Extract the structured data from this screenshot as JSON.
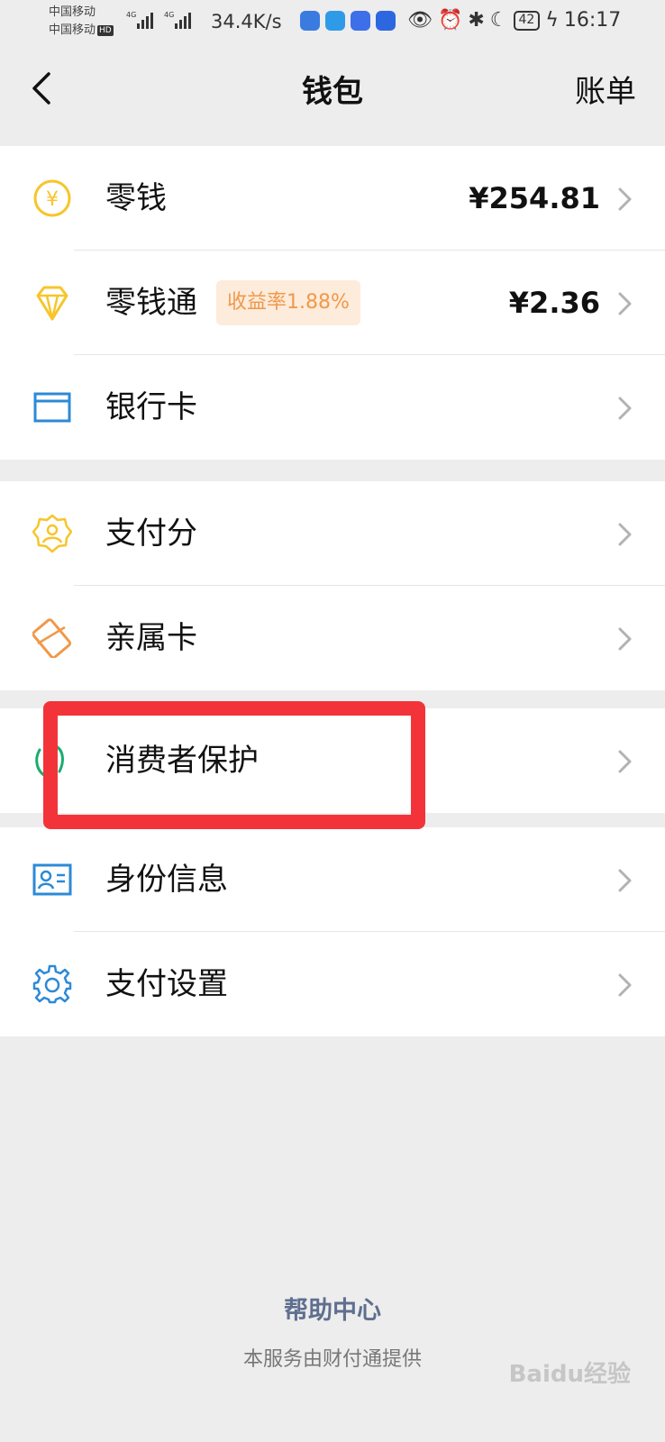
{
  "status_bar": {
    "carrier_1": "中国移动",
    "carrier_2": "中国移动",
    "hd_badge": "HD",
    "signal_label_1": "4G",
    "signal_label_2": "4G",
    "net_speed": "34.4K/s",
    "battery": "42",
    "time": "16:17",
    "icons": [
      "browser-app-icon",
      "message-app-icon",
      "baidu-app-icon",
      "bulb-app-icon",
      "eye-icon",
      "alarm-icon",
      "bluetooth-icon",
      "moon-icon",
      "battery-icon",
      "charging-icon"
    ]
  },
  "nav": {
    "back_icon": "chevron-left-icon",
    "title": "钱包",
    "right_action": "账单"
  },
  "groups": [
    {
      "items": [
        {
          "key": "change",
          "label": "零钱",
          "value": "¥254.81",
          "icon": "yuan-coin-icon",
          "color": "#f7c52a"
        },
        {
          "key": "change-pass",
          "label": "零钱通",
          "badge": "收益率1.88%",
          "value": "¥2.36",
          "icon": "diamond-icon",
          "color": "#f7c52a"
        },
        {
          "key": "bank-card",
          "label": "银行卡",
          "value": "",
          "icon": "bank-card-icon",
          "color": "#2c8ad6"
        }
      ]
    },
    {
      "items": [
        {
          "key": "pay-score",
          "label": "支付分",
          "value": "",
          "icon": "pay-score-badge-icon",
          "color": "#f7c52a"
        },
        {
          "key": "family-card",
          "label": "亲属卡",
          "value": "",
          "icon": "family-card-icon",
          "color": "#f0994a"
        }
      ]
    },
    {
      "items": [
        {
          "key": "consumer-protection",
          "label": "消费者保护",
          "value": "",
          "icon": "hand-shield-icon",
          "color": "#1aad6f"
        }
      ]
    },
    {
      "items": [
        {
          "key": "identity",
          "label": "身份信息",
          "value": "",
          "icon": "id-card-icon",
          "color": "#2c8ad6"
        },
        {
          "key": "pay-settings",
          "label": "支付设置",
          "value": "",
          "icon": "gear-icon",
          "color": "#2c8ad6"
        }
      ]
    }
  ],
  "footer": {
    "help_center": "帮助中心",
    "provider": "本服务由财付通提供"
  },
  "watermark": "Baidu经验",
  "highlight_color": "#f2343a"
}
